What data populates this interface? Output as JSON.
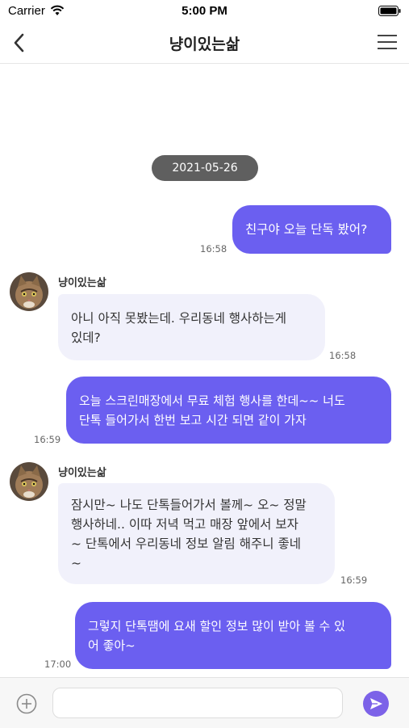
{
  "status_bar": {
    "carrier": "Carrier",
    "time": "5:00 PM"
  },
  "header": {
    "title": "냥이있는삶"
  },
  "date_divider": "2021-05-26",
  "messages": [
    {
      "side": "out",
      "text": "친구야 오늘 단독 봤어?",
      "time": "16:58"
    },
    {
      "side": "in",
      "sender": "냥이있는삶",
      "lines": [
        "아니 아직 못봤는데. 우리동네 행사하는게",
        "있데?"
      ],
      "time": "16:58"
    },
    {
      "side": "out",
      "lines": [
        "오늘 스크린매장에서 무료 체험 행사를 한데~~ 너도",
        "단톡 들어가서 한번 보고 시간 되면 같이 가자"
      ],
      "time": "16:59"
    },
    {
      "side": "in",
      "sender": "냥이있는삶",
      "lines": [
        "잠시만~ 나도 단톡들어가서 볼께~ 오~ 정말",
        "행사하네.. 이따 저녁 먹고 매장 앞에서 보자",
        "~ 단톡에서 우리동네 정보 알림 해주니 좋네",
        "~"
      ],
      "time": "16:59"
    },
    {
      "side": "out",
      "lines": [
        "그렇지 단톡땜에 요새 할인 정보 많이 받아 볼 수 있",
        "어 좋아~"
      ],
      "time": "17:00"
    }
  ],
  "composer": {
    "placeholder": ""
  },
  "colors": {
    "accent": "#6b5ff0",
    "incoming_bubble": "#f1f1fb",
    "date_chip": "#5f5f5f"
  },
  "icons": {
    "back": "chevron-left-icon",
    "menu": "hamburger-menu-icon",
    "attach": "plus-circle-icon",
    "send": "send-icon"
  }
}
